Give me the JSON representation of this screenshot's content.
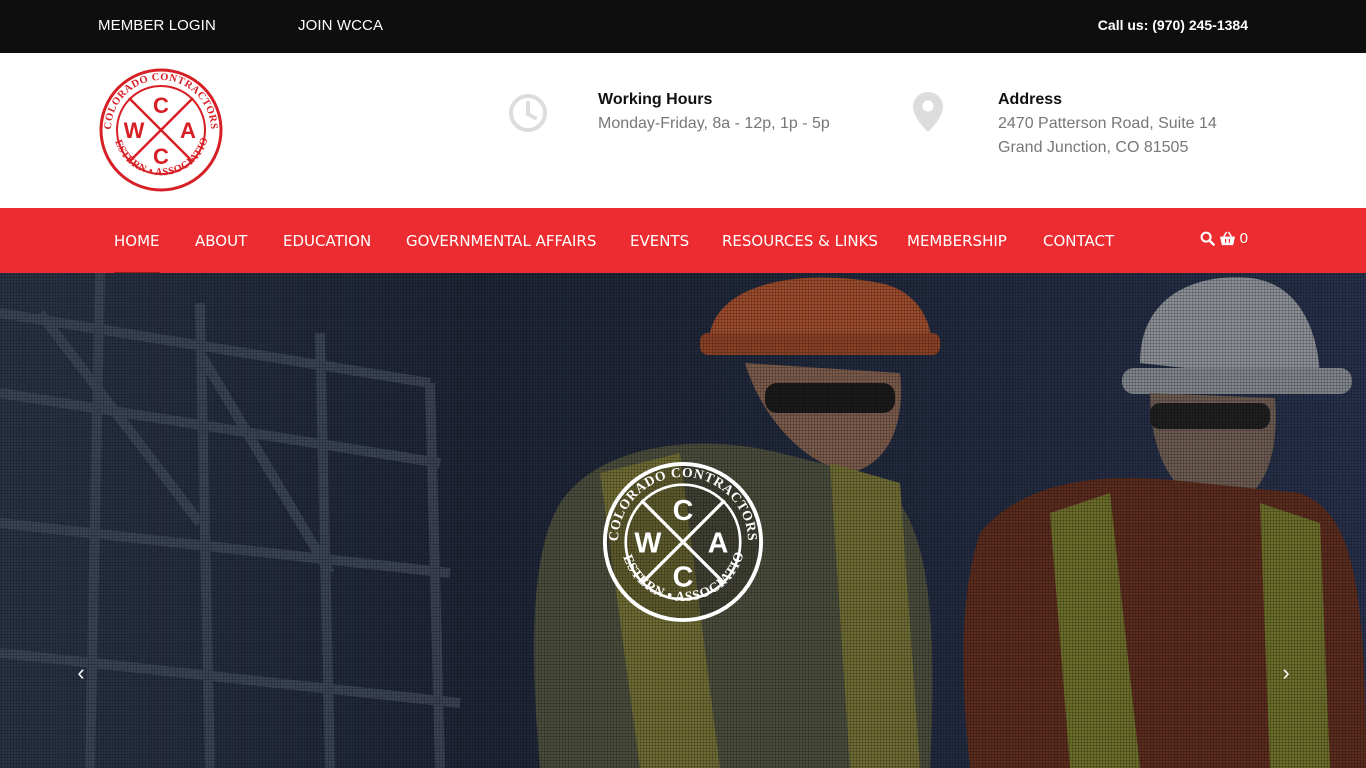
{
  "topbar": {
    "member_login": "MEMBER LOGIN",
    "join": "JOIN WCCA",
    "call": "Call us: (970) 245-1384"
  },
  "logo": {
    "letters": {
      "top": "C",
      "left": "W",
      "right": "A",
      "bottom": "C"
    },
    "ring_top": "COLORADO CONTRACTORS",
    "ring_bottom": "WESTERN • ASSOCIATION"
  },
  "working_hours": {
    "title": "Working Hours",
    "line1": "Monday-Friday, 8a - 12p, 1p - 5p"
  },
  "address": {
    "title": "Address",
    "line1": "2470 Patterson Road, Suite 14",
    "line2": "Grand Junction, CO 81505"
  },
  "nav": {
    "items": [
      {
        "label": "HOME"
      },
      {
        "label": "ABOUT"
      },
      {
        "label": "EDUCATION"
      },
      {
        "label": "GOVERNMENTAL AFFAIRS"
      },
      {
        "label": "EVENTS"
      },
      {
        "label": "RESOURCES & LINKS"
      },
      {
        "label": "MEMBERSHIP"
      },
      {
        "label": "CONTACT"
      }
    ],
    "cart_count": "0"
  },
  "hero": {
    "prev_arrow": "‹",
    "next_arrow": "›"
  },
  "colors": {
    "brand_red": "#ed2c31",
    "topbar_bg": "#0e0e0e"
  },
  "icons": [
    "clock-icon",
    "map-pin-icon",
    "search-icon",
    "basket-icon",
    "chevron-left-icon",
    "chevron-right-icon"
  ]
}
